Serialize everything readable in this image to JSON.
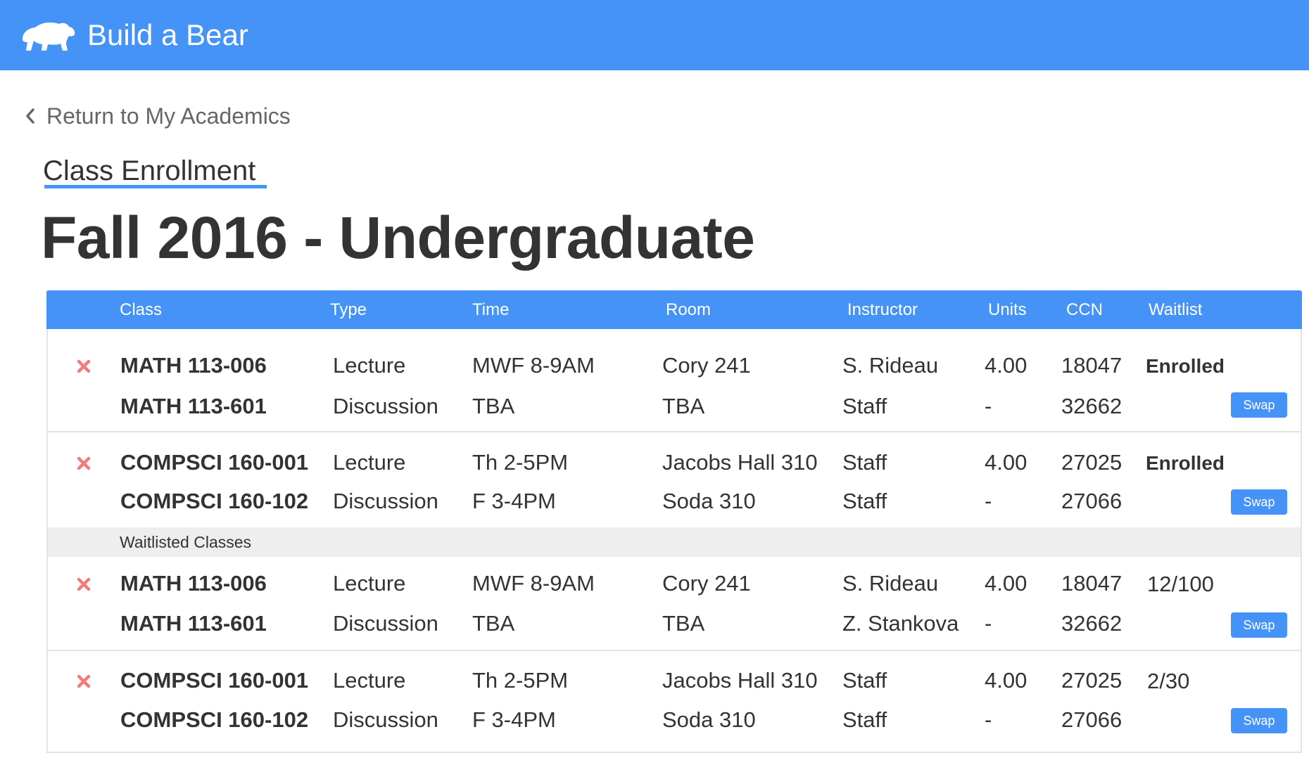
{
  "app": {
    "title": "Build a Bear",
    "logo_icon": "bear-icon"
  },
  "nav": {
    "back_label": "Return to My Academics"
  },
  "page": {
    "section_title": "Class Enrollment",
    "term_title": "Fall 2016 - Undergraduate"
  },
  "colors": {
    "brand": "#4593f6",
    "remove": "#f27c7c",
    "divider": "#e4e4e4",
    "waitlist_band": "#eeeeee"
  },
  "table": {
    "columns": [
      "Class",
      "Type",
      "Time",
      "Room",
      "Instructor",
      "Units",
      "CCN",
      "Waitlist"
    ],
    "waitlisted_label": "Waitlisted Classes",
    "swap_label": "Swap",
    "enrolled": [
      {
        "status": "Enrolled",
        "rows": [
          {
            "cls": "MATH 113-006",
            "type": "Lecture",
            "time": "MWF 8-9AM",
            "room": "Cory 241",
            "instructor": "S. Rideau",
            "units": "4.00",
            "ccn": "18047"
          },
          {
            "cls": "MATH 113-601",
            "type": "Discussion",
            "time": "TBA",
            "room": "TBA",
            "instructor": "Staff",
            "units": "-",
            "ccn": "32662"
          }
        ]
      },
      {
        "status": "Enrolled",
        "rows": [
          {
            "cls": "COMPSCI 160-001",
            "type": "Lecture",
            "time": "Th 2-5PM",
            "room": "Jacobs Hall 310",
            "instructor": "Staff",
            "units": "4.00",
            "ccn": "27025"
          },
          {
            "cls": "COMPSCI 160-102",
            "type": "Discussion",
            "time": "F 3-4PM",
            "room": "Soda 310",
            "instructor": "Staff",
            "units": "-",
            "ccn": "27066"
          }
        ]
      }
    ],
    "waitlisted": [
      {
        "status": "12/100",
        "rows": [
          {
            "cls": "MATH 113-006",
            "type": "Lecture",
            "time": "MWF 8-9AM",
            "room": "Cory 241",
            "instructor": "S. Rideau",
            "units": "4.00",
            "ccn": "18047"
          },
          {
            "cls": "MATH 113-601",
            "type": "Discussion",
            "time": "TBA",
            "room": "TBA",
            "instructor": "Z. Stankova",
            "units": "-",
            "ccn": "32662"
          }
        ]
      },
      {
        "status": "2/30",
        "rows": [
          {
            "cls": "COMPSCI 160-001",
            "type": "Lecture",
            "time": "Th 2-5PM",
            "room": "Jacobs Hall 310",
            "instructor": "Staff",
            "units": "4.00",
            "ccn": "27025"
          },
          {
            "cls": "COMPSCI 160-102",
            "type": "Discussion",
            "time": "F 3-4PM",
            "room": "Soda 310",
            "instructor": "Staff",
            "units": "-",
            "ccn": "27066"
          }
        ]
      }
    ]
  }
}
